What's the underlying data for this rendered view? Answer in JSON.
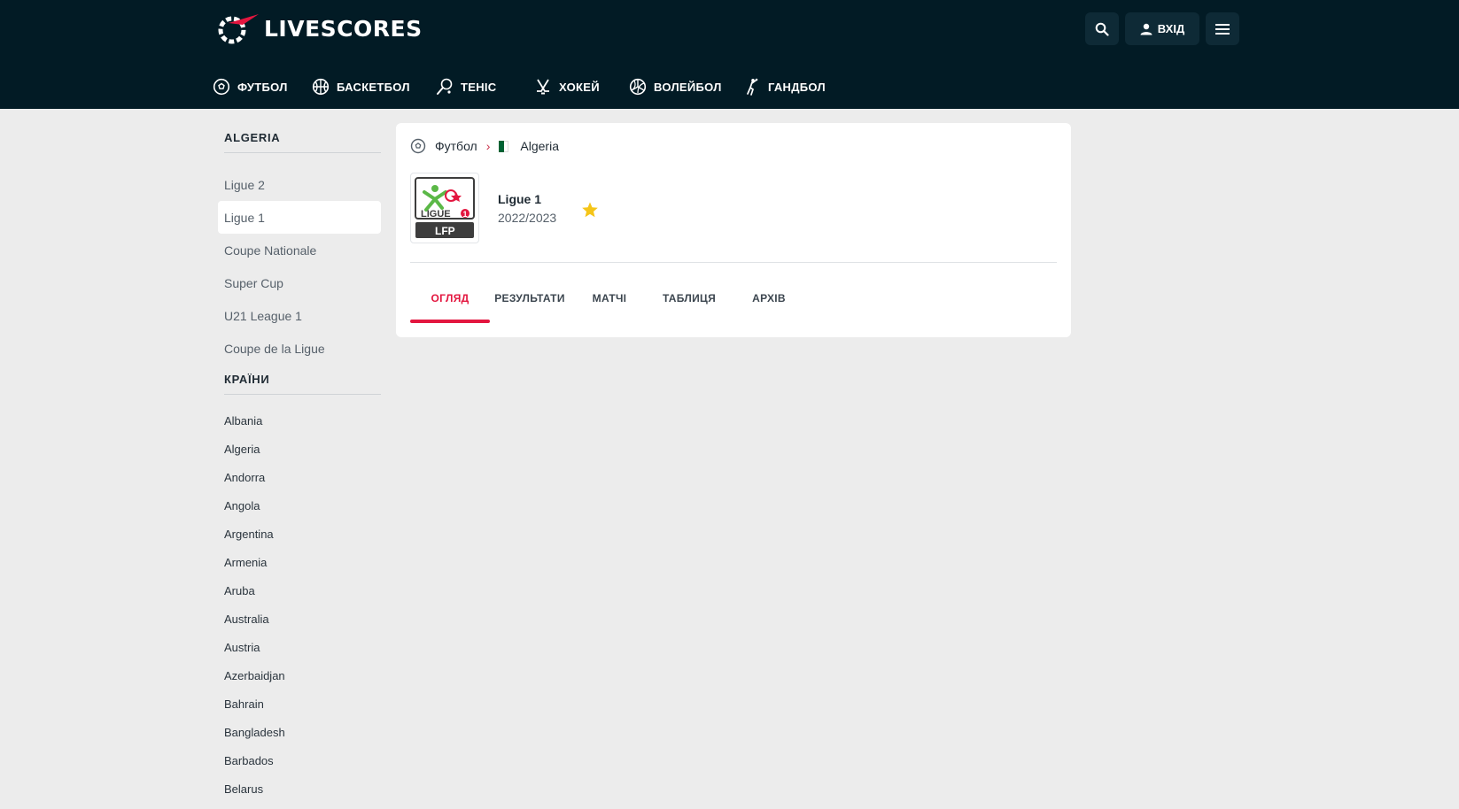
{
  "header": {
    "logo_text": "LIVESCORES",
    "login_label": "ВХІД",
    "sports": [
      {
        "label": "ФУТБОЛ",
        "icon": "soccer-ball-icon"
      },
      {
        "label": "БАСКЕТБОЛ",
        "icon": "basketball-icon"
      },
      {
        "label": "ТЕНІС",
        "icon": "tennis-racket-icon"
      },
      {
        "label": "ХОКЕЙ",
        "icon": "hockey-sticks-icon"
      },
      {
        "label": "ВОЛЕЙБОЛ",
        "icon": "volleyball-icon"
      },
      {
        "label": "ГАНДБОЛ",
        "icon": "handball-player-icon"
      }
    ]
  },
  "sidebar": {
    "country_title": "ALGERIA",
    "leagues": [
      "Ligue 2",
      "Ligue 1",
      "Coupe Nationale",
      "Super Cup",
      "U21 League 1",
      "Coupe de la Ligue"
    ],
    "active_league": "Ligue 1",
    "countries_title": "КРАЇНИ",
    "countries": [
      "Albania",
      "Algeria",
      "Andorra",
      "Angola",
      "Argentina",
      "Armenia",
      "Aruba",
      "Australia",
      "Austria",
      "Azerbaidjan",
      "Bahrain",
      "Bangladesh",
      "Barbados",
      "Belarus"
    ]
  },
  "main": {
    "breadcrumb": {
      "sport": "Футбол",
      "country": "Algeria"
    },
    "league": {
      "name": "Ligue 1",
      "season": "2022/2023",
      "logo_text": "LIGUE",
      "logo_sub": "LFP",
      "logo_num": "1"
    },
    "tabs": [
      "ОГЛЯД",
      "РЕЗУЛЬТАТИ",
      "МАТЧІ",
      "ТАБЛИЦЯ",
      "АРХІВ"
    ],
    "active_tab": "ОГЛЯД"
  },
  "colors": {
    "header_bg": "#021b25",
    "accent": "#e3163f",
    "star": "#f5c518",
    "page_bg": "#ececec"
  }
}
